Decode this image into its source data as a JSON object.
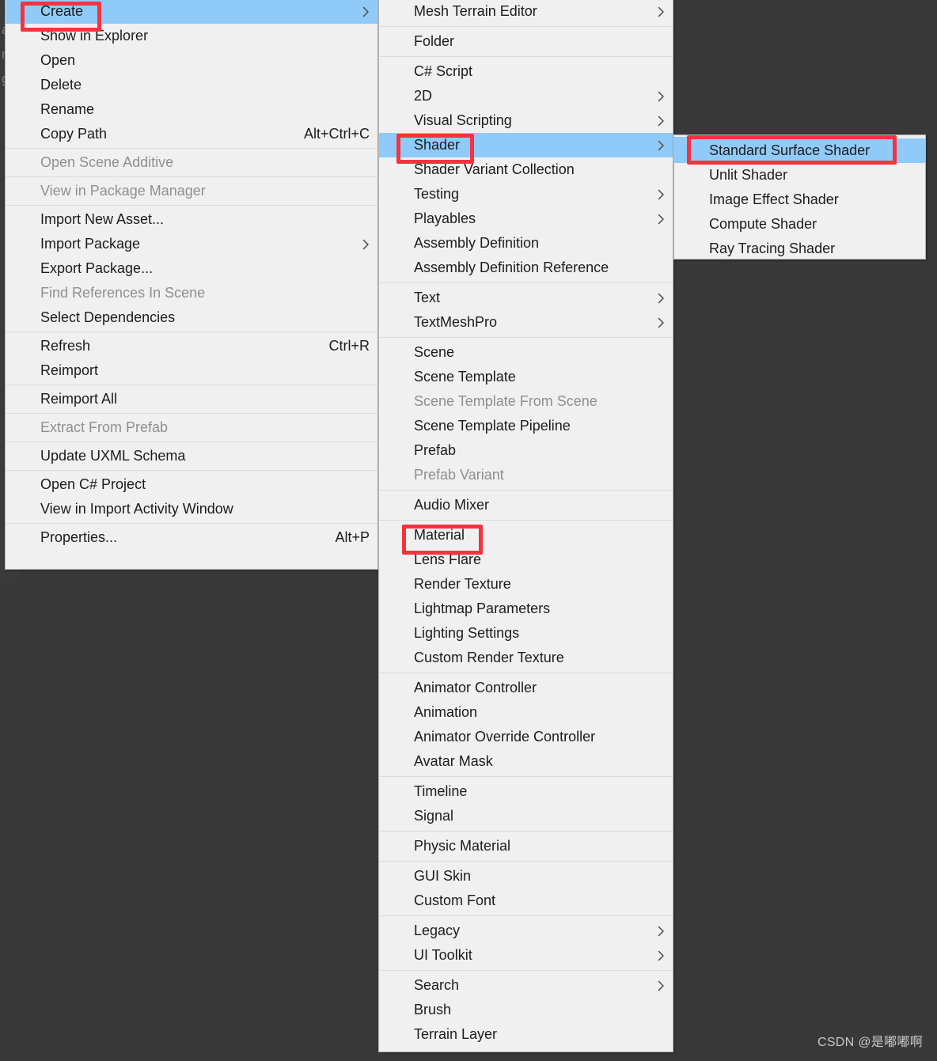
{
  "window": {
    "background_color": "#393939",
    "menu_background": "#f0f0f0",
    "highlight_color": "#90caf9",
    "annotation_color": "#f5333f",
    "disabled_text_color": "#8f8f8f",
    "backdrop_glyphs": "a\nn\ng"
  },
  "watermark": {
    "text": "CSDN @是嘟嘟啊"
  },
  "context_menu": {
    "name": "asset-context-menu",
    "items": [
      {
        "label": "Create",
        "shortcut": "",
        "submenu": true,
        "disabled": false,
        "highlighted": true
      },
      {
        "label": "Show in Explorer",
        "shortcut": "",
        "submenu": false,
        "disabled": false
      },
      {
        "label": "Open",
        "shortcut": "",
        "submenu": false,
        "disabled": false
      },
      {
        "label": "Delete",
        "shortcut": "",
        "submenu": false,
        "disabled": false
      },
      {
        "label": "Rename",
        "shortcut": "",
        "submenu": false,
        "disabled": false
      },
      {
        "label": "Copy Path",
        "shortcut": "Alt+Ctrl+C",
        "submenu": false,
        "disabled": false
      },
      {
        "separator": true
      },
      {
        "label": "Open Scene Additive",
        "shortcut": "",
        "submenu": false,
        "disabled": true
      },
      {
        "separator": true
      },
      {
        "label": "View in Package Manager",
        "shortcut": "",
        "submenu": false,
        "disabled": true
      },
      {
        "separator": true
      },
      {
        "label": "Import New Asset...",
        "shortcut": "",
        "submenu": false,
        "disabled": false
      },
      {
        "label": "Import Package",
        "shortcut": "",
        "submenu": true,
        "disabled": false
      },
      {
        "label": "Export Package...",
        "shortcut": "",
        "submenu": false,
        "disabled": false
      },
      {
        "label": "Find References In Scene",
        "shortcut": "",
        "submenu": false,
        "disabled": true
      },
      {
        "label": "Select Dependencies",
        "shortcut": "",
        "submenu": false,
        "disabled": false
      },
      {
        "separator": true
      },
      {
        "label": "Refresh",
        "shortcut": "Ctrl+R",
        "submenu": false,
        "disabled": false
      },
      {
        "label": "Reimport",
        "shortcut": "",
        "submenu": false,
        "disabled": false
      },
      {
        "separator": true
      },
      {
        "label": "Reimport All",
        "shortcut": "",
        "submenu": false,
        "disabled": false
      },
      {
        "separator": true
      },
      {
        "label": "Extract From Prefab",
        "shortcut": "",
        "submenu": false,
        "disabled": true
      },
      {
        "separator": true
      },
      {
        "label": "Update UXML Schema",
        "shortcut": "",
        "submenu": false,
        "disabled": false
      },
      {
        "separator": true
      },
      {
        "label": "Open C# Project",
        "shortcut": "",
        "submenu": false,
        "disabled": false
      },
      {
        "label": "View in Import Activity Window",
        "shortcut": "",
        "submenu": false,
        "disabled": false
      },
      {
        "separator": true
      },
      {
        "label": "Properties...",
        "shortcut": "Alt+P",
        "submenu": false,
        "disabled": false
      }
    ]
  },
  "create_menu": {
    "name": "create-submenu",
    "items": [
      {
        "label": "Mesh Terrain Editor",
        "submenu": true,
        "disabled": false
      },
      {
        "separator": true
      },
      {
        "label": "Folder",
        "submenu": false,
        "disabled": false
      },
      {
        "separator": true
      },
      {
        "label": "C# Script",
        "submenu": false,
        "disabled": false
      },
      {
        "label": "2D",
        "submenu": true,
        "disabled": false
      },
      {
        "label": "Visual Scripting",
        "submenu": true,
        "disabled": false
      },
      {
        "label": "Shader",
        "submenu": true,
        "disabled": false,
        "highlighted": true
      },
      {
        "label": "Shader Variant Collection",
        "submenu": false,
        "disabled": false
      },
      {
        "label": "Testing",
        "submenu": true,
        "disabled": false
      },
      {
        "label": "Playables",
        "submenu": true,
        "disabled": false
      },
      {
        "label": "Assembly Definition",
        "submenu": false,
        "disabled": false
      },
      {
        "label": "Assembly Definition Reference",
        "submenu": false,
        "disabled": false
      },
      {
        "separator": true
      },
      {
        "label": "Text",
        "submenu": true,
        "disabled": false
      },
      {
        "label": "TextMeshPro",
        "submenu": true,
        "disabled": false
      },
      {
        "separator": true
      },
      {
        "label": "Scene",
        "submenu": false,
        "disabled": false
      },
      {
        "label": "Scene Template",
        "submenu": false,
        "disabled": false
      },
      {
        "label": "Scene Template From Scene",
        "submenu": false,
        "disabled": true
      },
      {
        "label": "Scene Template Pipeline",
        "submenu": false,
        "disabled": false
      },
      {
        "label": "Prefab",
        "submenu": false,
        "disabled": false
      },
      {
        "label": "Prefab Variant",
        "submenu": false,
        "disabled": true
      },
      {
        "separator": true
      },
      {
        "label": "Audio Mixer",
        "submenu": false,
        "disabled": false
      },
      {
        "separator": true
      },
      {
        "label": "Material",
        "submenu": false,
        "disabled": false
      },
      {
        "label": "Lens Flare",
        "submenu": false,
        "disabled": false
      },
      {
        "label": "Render Texture",
        "submenu": false,
        "disabled": false
      },
      {
        "label": "Lightmap Parameters",
        "submenu": false,
        "disabled": false
      },
      {
        "label": "Lighting Settings",
        "submenu": false,
        "disabled": false
      },
      {
        "label": "Custom Render Texture",
        "submenu": false,
        "disabled": false
      },
      {
        "separator": true
      },
      {
        "label": "Animator Controller",
        "submenu": false,
        "disabled": false
      },
      {
        "label": "Animation",
        "submenu": false,
        "disabled": false
      },
      {
        "label": "Animator Override Controller",
        "submenu": false,
        "disabled": false
      },
      {
        "label": "Avatar Mask",
        "submenu": false,
        "disabled": false
      },
      {
        "separator": true
      },
      {
        "label": "Timeline",
        "submenu": false,
        "disabled": false
      },
      {
        "label": "Signal",
        "submenu": false,
        "disabled": false
      },
      {
        "separator": true
      },
      {
        "label": "Physic Material",
        "submenu": false,
        "disabled": false
      },
      {
        "separator": true
      },
      {
        "label": "GUI Skin",
        "submenu": false,
        "disabled": false
      },
      {
        "label": "Custom Font",
        "submenu": false,
        "disabled": false
      },
      {
        "separator": true
      },
      {
        "label": "Legacy",
        "submenu": true,
        "disabled": false
      },
      {
        "label": "UI Toolkit",
        "submenu": true,
        "disabled": false
      },
      {
        "separator": true
      },
      {
        "label": "Search",
        "submenu": true,
        "disabled": false
      },
      {
        "label": "Brush",
        "submenu": false,
        "disabled": false
      },
      {
        "label": "Terrain Layer",
        "submenu": false,
        "disabled": false
      }
    ]
  },
  "shader_menu": {
    "name": "shader-submenu",
    "items": [
      {
        "label": "Standard Surface Shader",
        "submenu": false,
        "disabled": false,
        "highlighted": true
      },
      {
        "label": "Unlit Shader",
        "submenu": false,
        "disabled": false
      },
      {
        "label": "Image Effect Shader",
        "submenu": false,
        "disabled": false
      },
      {
        "label": "Compute Shader",
        "submenu": false,
        "disabled": false
      },
      {
        "label": "Ray Tracing Shader",
        "submenu": false,
        "disabled": false
      }
    ]
  },
  "annotations": [
    {
      "target": "Create",
      "shape": "rectangle"
    },
    {
      "target": "Shader",
      "shape": "rectangle"
    },
    {
      "target": "Material",
      "shape": "rectangle"
    },
    {
      "target": "Standard Surface Shader",
      "shape": "rectangle"
    }
  ]
}
